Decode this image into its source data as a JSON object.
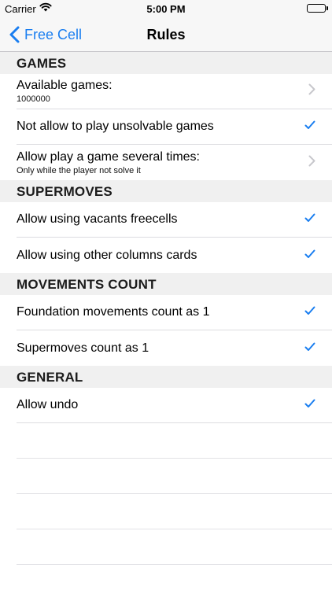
{
  "status_bar": {
    "carrier": "Carrier",
    "time": "5:00 PM"
  },
  "nav": {
    "back_label": "Free Cell",
    "title": "Rules"
  },
  "sections": [
    {
      "header": "GAMES",
      "rows": [
        {
          "label": "Available games:",
          "sub": "1000000",
          "accessory": "chevron"
        },
        {
          "label": "Not allow to play unsolvable games",
          "accessory": "checkmark"
        },
        {
          "label": "Allow play a game several times:",
          "sub": "Only while the player not solve it",
          "accessory": "chevron"
        }
      ]
    },
    {
      "header": "SUPERMOVES",
      "rows": [
        {
          "label": "Allow using vacants freecells",
          "accessory": "checkmark"
        },
        {
          "label": "Allow using other columns cards",
          "accessory": "checkmark"
        }
      ]
    },
    {
      "header": "MOVEMENTS COUNT",
      "rows": [
        {
          "label": "Foundation movements count as 1",
          "accessory": "checkmark"
        },
        {
          "label": "Supermoves count as 1",
          "accessory": "checkmark"
        }
      ]
    },
    {
      "header": "GENERAL",
      "rows": [
        {
          "label": "Allow undo",
          "accessory": "checkmark"
        }
      ]
    }
  ],
  "colors": {
    "accent": "#1a7ef0",
    "chevron": "#c7c7cc",
    "section_bg": "#f0f0f0"
  }
}
